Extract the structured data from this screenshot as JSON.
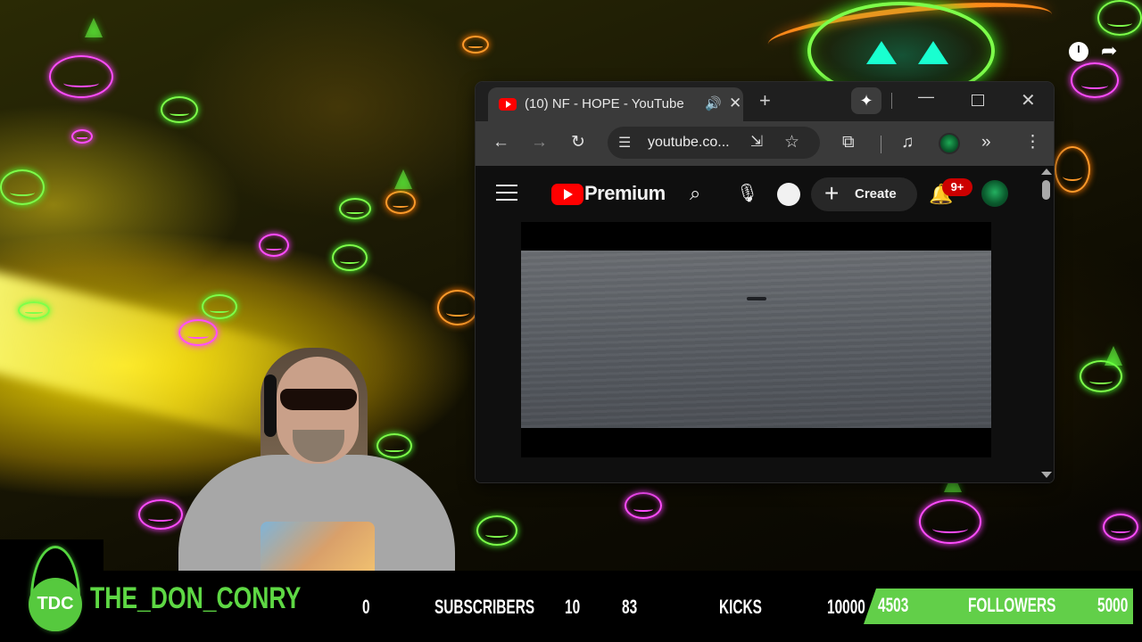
{
  "browser": {
    "tab": {
      "title": "(10) NF - HOPE - YouTube",
      "audio_icon": "🔊",
      "close_icon": "✕"
    },
    "new_tab_icon": "+",
    "gemini_icon": "✦",
    "window": {
      "minimize": "—",
      "close": "✕"
    },
    "toolbar": {
      "back_icon": "←",
      "forward_icon": "→",
      "reload_icon": "↻",
      "tune_icon": "☰",
      "url": "youtube.co...",
      "install_icon": "⇲",
      "star_icon": "☆",
      "extensions_icon": "⧉",
      "media_icon": "♫",
      "more_tabs_icon": "»",
      "menu_icon": "⋮"
    }
  },
  "youtube": {
    "logo_text": "Premium",
    "search_icon": "⌕",
    "mic_icon": "🎙",
    "create_plus": "+",
    "create_label": "Create",
    "bell_icon": "🔔",
    "notifications_badge": "9+"
  },
  "overlay": {
    "share_icon": "➦"
  },
  "stream_bar": {
    "logo_text": "TDC",
    "channel_name": "THE_DON_CONRY",
    "subs_count": "0",
    "subs_label": "SUBSCRIBERS",
    "subs_goal": "10",
    "kicks_count": "83",
    "kicks_label": "KICKS",
    "kicks_goal": "10000",
    "followers_count": "4503",
    "followers_label": "FOLLOWERS",
    "followers_goal": "5000",
    "accent_color": "#5ed844"
  }
}
